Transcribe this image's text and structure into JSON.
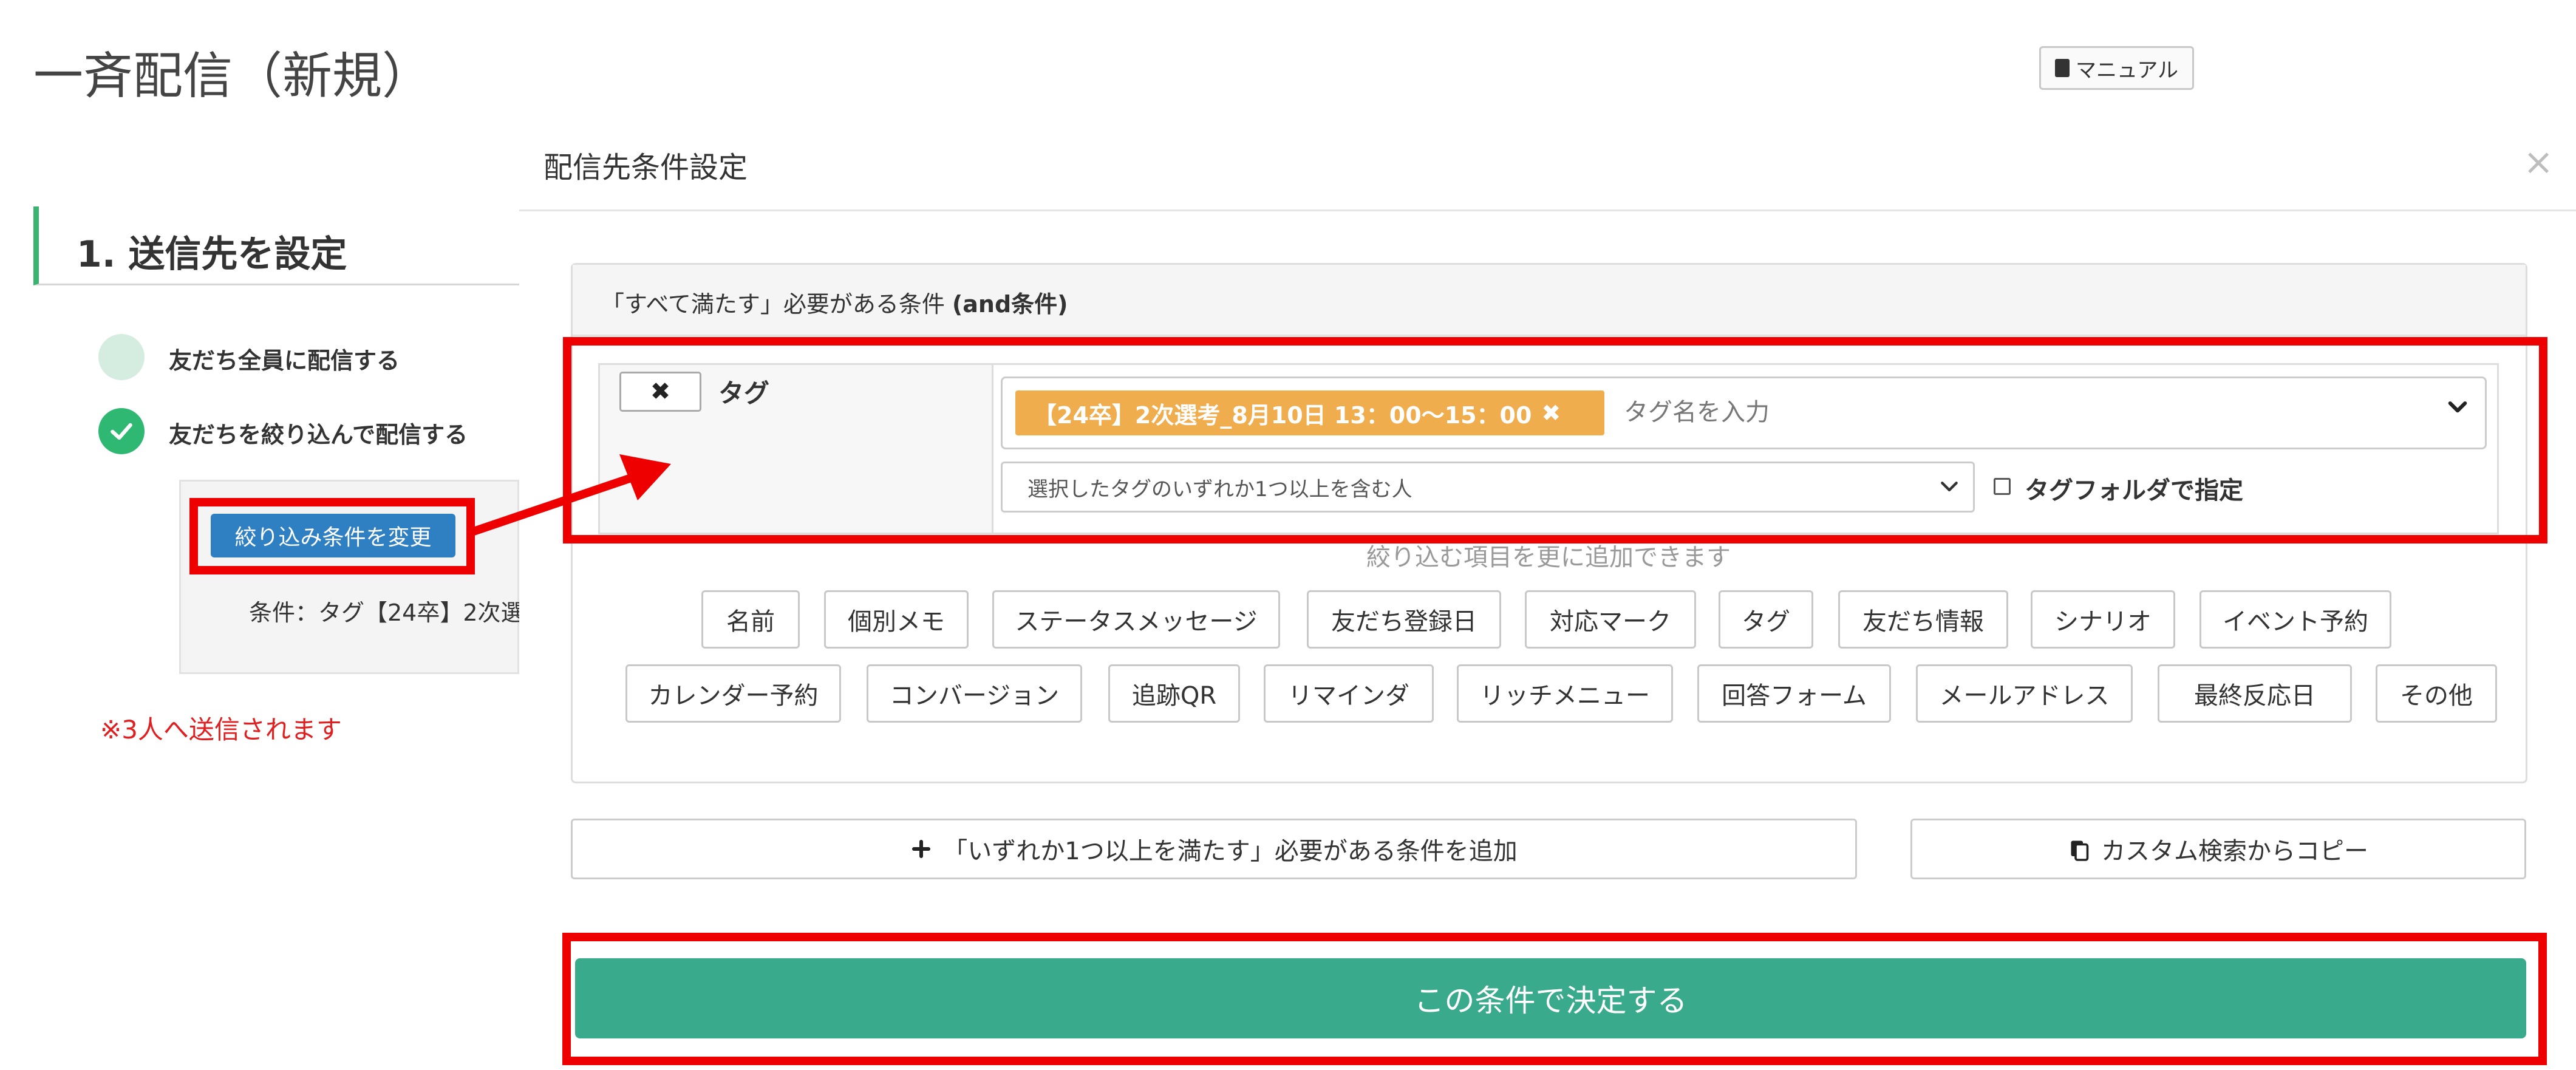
{
  "page": {
    "title": "一斉配信（新規）",
    "manual_label": "マニュアル",
    "step_title": "1. 送信先を設定",
    "option_all": "友だち全員に配信する",
    "option_filter": "友だちを絞り込んで配信する",
    "filter_button": "絞り込み条件を変更",
    "condition_text": "条件：タグ【24卒】2次選",
    "warning": "※3人へ送信されます"
  },
  "modal": {
    "title": "配信先条件設定",
    "close_symbol": "×",
    "and_header_prefix": "「すべて満たす」必要がある条件 ",
    "and_header_bold": "(and条件)",
    "condition": {
      "remove_symbol": "✖",
      "type_label": "タグ",
      "selected_tag": "【24卒】2次選考_8月10日 13：00〜15：00",
      "chip_remove": "✖",
      "tag_placeholder": "タグ名を入力",
      "match_mode": "選択したタグのいずれか1つ以上を含む人",
      "folder_label": "タグフォルダで指定",
      "folder_checked": false
    },
    "add_hint": "絞り込む項目を更に追加できます",
    "filter_items_row1": [
      "名前",
      "個別メモ",
      "ステータスメッセージ",
      "友だち登録日",
      "対応マーク",
      "タグ",
      "友だち情報",
      "シナリオ",
      "イベント予約"
    ],
    "filter_items_row2": [
      "カレンダー予約",
      "コンバージョン",
      "追跡QR",
      "リマインダ",
      "リッチメニュー",
      "回答フォーム",
      "メールアドレス",
      "最終反応日",
      "その他"
    ],
    "add_or_condition": "「いずれか1つ以上を満たす」必要がある条件を追加",
    "copy_custom": "カスタム検索からコピー",
    "submit": "この条件で決定する"
  },
  "colors": {
    "annotation_red": "#ee0000",
    "tag_chip": "#f0ad4e",
    "primary_blue": "#2f7fc3",
    "submit_green": "#3aaa8c",
    "check_green": "#2eb872",
    "warning_red": "#e02020"
  },
  "icons": {
    "manual": "book-icon",
    "checked": "check-icon",
    "add": "plus-icon",
    "copy": "copy-icon",
    "dropdown": "chevron-down-icon",
    "annotation": "arrow-icon"
  }
}
